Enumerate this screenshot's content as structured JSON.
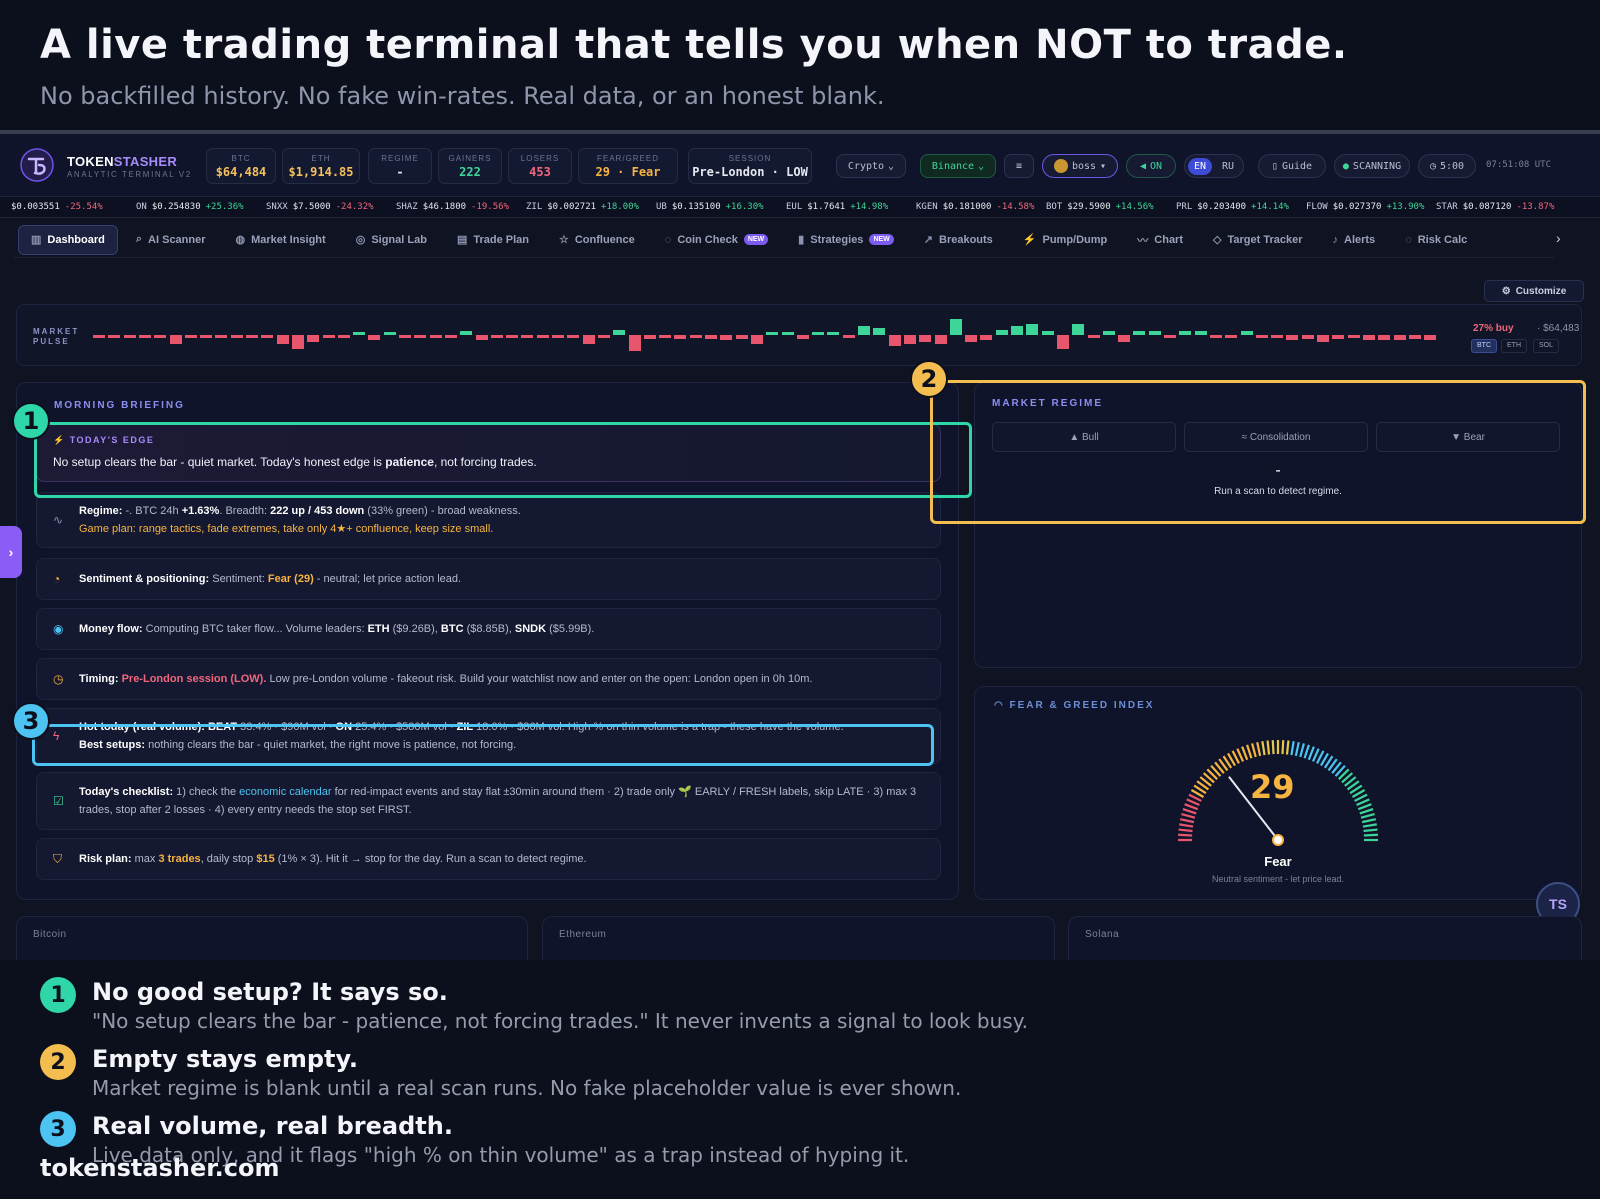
{
  "hero": {
    "title": "A live trading terminal that tells you when NOT to trade.",
    "subtitle": "No backfilled history. No fake win-rates. Real data, or an honest blank."
  },
  "app": {
    "brand_a": "TOKEN",
    "brand_b": "STASHER",
    "brand_sub": "ANALYTIC TERMINAL V2",
    "stats": [
      {
        "label": "BTC",
        "value": "$64,484",
        "color": "#f6c05a"
      },
      {
        "label": "ETH",
        "value": "$1,914.85",
        "color": "#f6c05a"
      },
      {
        "label": "REGIME",
        "value": "-",
        "color": "#e6e8f0"
      },
      {
        "label": "GAINERS",
        "value": "222",
        "color": "#3ed598"
      },
      {
        "label": "LOSERS",
        "value": "453",
        "color": "#f0677c"
      },
      {
        "label": "FEAR/GREED",
        "value": "29 · Fear",
        "color": "#f6b441"
      },
      {
        "label": "SESSION",
        "value": "Pre-London · LOW",
        "color": "#e6e8f0"
      }
    ],
    "controls": {
      "market": "Crypto",
      "exchange": "Binance",
      "user": "boss",
      "sound": "ON",
      "lang_en": "EN",
      "lang_ru": "RU",
      "guide": "Guide",
      "scanning": "SCANNING",
      "timer": "5:00",
      "clock": "07:51:08 UTC"
    },
    "ticker": [
      {
        "sym": "",
        "price": "$0.003551",
        "chg": "-25.54%"
      },
      {
        "sym": "ON",
        "price": "$0.254830",
        "chg": "+25.36%"
      },
      {
        "sym": "SNXX",
        "price": "$7.5000",
        "chg": "-24.32%"
      },
      {
        "sym": "SHAZ",
        "price": "$46.1800",
        "chg": "-19.56%"
      },
      {
        "sym": "ZIL",
        "price": "$0.002721",
        "chg": "+18.00%"
      },
      {
        "sym": "UB",
        "price": "$0.135100",
        "chg": "+16.30%"
      },
      {
        "sym": "EUL",
        "price": "$1.7641",
        "chg": "+14.98%"
      },
      {
        "sym": "KGEN",
        "price": "$0.181000",
        "chg": "-14.58%"
      },
      {
        "sym": "BOT",
        "price": "$29.5900",
        "chg": "+14.56%"
      },
      {
        "sym": "PRL",
        "price": "$0.203400",
        "chg": "+14.14%"
      },
      {
        "sym": "FLOW",
        "price": "$0.027370",
        "chg": "+13.90%"
      },
      {
        "sym": "STAR",
        "price": "$0.087120",
        "chg": "-13.87%"
      }
    ],
    "tabs": [
      {
        "label": "Dashboard",
        "icon": "▥",
        "active": true,
        "badge": ""
      },
      {
        "label": "AI Scanner",
        "icon": "⌕",
        "badge": ""
      },
      {
        "label": "Market Insight",
        "icon": "◍",
        "badge": ""
      },
      {
        "label": "Signal Lab",
        "icon": "◎",
        "badge": ""
      },
      {
        "label": "Trade Plan",
        "icon": "▤",
        "badge": ""
      },
      {
        "label": "Confluence",
        "icon": "☆",
        "badge": ""
      },
      {
        "label": "Coin Check",
        "icon": "◌",
        "badge": "NEW"
      },
      {
        "label": "Strategies",
        "icon": "▮",
        "badge": "NEW"
      },
      {
        "label": "Breakouts",
        "icon": "↗",
        "badge": ""
      },
      {
        "label": "Pump/Dump",
        "icon": "⚡",
        "badge": ""
      },
      {
        "label": "Chart",
        "icon": "〰",
        "badge": ""
      },
      {
        "label": "Target Tracker",
        "icon": "◇",
        "badge": ""
      },
      {
        "label": "Alerts",
        "icon": "♪",
        "badge": ""
      },
      {
        "label": "Risk Calc",
        "icon": "◌",
        "badge": ""
      }
    ],
    "customize": "Customize",
    "pulse": {
      "label_1": "MARKET",
      "label_2": "PULSE",
      "buy": "27% buy",
      "price": "· $64,483",
      "coins": [
        "BTC",
        "ETH",
        "SOL"
      ],
      "bars": [
        -0.1,
        -0.1,
        -0.1,
        -0.1,
        -0.1,
        -0.5,
        -0.1,
        -0.1,
        -0.1,
        -0.1,
        -0.1,
        -0.1,
        -0.5,
        -0.8,
        -0.4,
        -0.1,
        -0.1,
        0.15,
        -0.3,
        0.1,
        -0.1,
        -0.1,
        -0.1,
        -0.1,
        0.2,
        -0.3,
        -0.1,
        -0.1,
        -0.1,
        -0.1,
        -0.1,
        -0.1,
        -0.5,
        -0.1,
        0.3,
        -0.9,
        -0.2,
        -0.1,
        -0.2,
        -0.1,
        -0.2,
        -0.3,
        -0.2,
        -0.5,
        0.15,
        0.1,
        -0.2,
        0.1,
        0.15,
        -0.1,
        0.5,
        0.4,
        -0.6,
        -0.5,
        -0.4,
        -0.5,
        0.9,
        -0.4,
        -0.3,
        0.3,
        0.5,
        0.6,
        0.2,
        -0.8,
        0.6,
        -0.1,
        0.2,
        -0.4,
        0.25,
        0.2,
        -0.1,
        0.2,
        0.25,
        -0.1,
        -0.1,
        0.2,
        -0.1,
        -0.1,
        -0.3,
        -0.2,
        -0.4,
        -0.2,
        -0.1,
        -0.3,
        -0.3,
        -0.3,
        -0.2,
        -0.3
      ]
    },
    "briefing": {
      "title": "MORNING BRIEFING",
      "edge_label": "TODAY'S EDGE",
      "edge_a": "No setup clears the bar - quiet market. Today's honest edge is ",
      "edge_b": "patience",
      "edge_c": ", not forcing trades.",
      "regime_html_1": "Regime:",
      "regime_t1": " -. BTC 24h ",
      "regime_b1": "+1.63%",
      "regime_t2": ". Breadth: ",
      "regime_b2": "222 up / 453 down",
      "regime_t3": " (33% green) - broad weakness.",
      "regime_plan": "Game plan: range tactics, fade extremes, take only 4★+ confluence, keep size small.",
      "sent_b": "Sentiment & positioning:",
      "sent_t1": " Sentiment: ",
      "sent_o": "Fear (29)",
      "sent_t2": " - neutral; let price action lead.",
      "money_b": "Money flow:",
      "money_t1": " Computing BTC taker flow... Volume leaders: ",
      "money_e": "ETH",
      "money_t2": " ($9.26B), ",
      "money_btc": "BTC",
      "money_t3": " ($8.85B), ",
      "money_s": "SNDK",
      "money_t4": " ($5.99B).",
      "timing_b": "Timing:",
      "timing_r": " Pre-London session (LOW).",
      "timing_t": " Low pre-London volume - fakeout risk. Build your watchlist now and enter on the open: London open in 0h 10m.",
      "hot_b": "Hot today (real volume): BEAT",
      "hot_t1": " 33.4% · $90M vol · ",
      "hot_on": "ON",
      "hot_t2": " 25.4% · $580M vol · ",
      "hot_zil": "ZIL",
      "hot_t3": " 18.0% · $86M vol. High % on thin volume is a trap - these have the volume.",
      "hot_best": "Best setups:",
      "hot_t4": " nothing clears the bar - quiet market, the right move is patience, not forcing.",
      "check_b": "Today's checklist:",
      "check_t1": " 1) check the ",
      "check_link": "economic calendar",
      "check_t2": " for red-impact events and stay flat ±30min around them · 2) trade only 🌱 EARLY / FRESH labels, skip LATE · 3) max 3 trades, stop after 2 losses · 4) every entry needs the stop set FIRST.",
      "risk_b": "Risk plan:",
      "risk_t1": " max ",
      "risk_o1": "3 trades",
      "risk_t2": ", daily stop ",
      "risk_o2": "$15",
      "risk_t3": " (1% × 3). Hit it → stop for the day. Run a scan to detect regime."
    },
    "regime": {
      "title": "MARKET REGIME",
      "bull": "▲ Bull",
      "cons": "≈ Consolidation",
      "bear": "▼ Bear",
      "value": "-",
      "hint": "Run a scan to detect regime."
    },
    "fear": {
      "title": "FEAR & GREED INDEX",
      "value": "29",
      "label": "Fear",
      "hint": "Neutral sentiment - let price lead."
    },
    "coins_row": [
      "Bitcoin",
      "Ethereum",
      "Solana"
    ]
  },
  "callouts": [
    {
      "num": "1",
      "title": "No good setup? It says so.",
      "desc": "\"No setup clears the bar - patience, not forcing trades.\" It never invents a signal to look busy.",
      "color": "#2fd6a8"
    },
    {
      "num": "2",
      "title": "Empty stays empty.",
      "desc": "Market regime is blank until a real scan runs. No fake placeholder value is ever shown.",
      "color": "#f4bd4f"
    },
    {
      "num": "3",
      "title": "Real volume, real breadth.",
      "desc": "Live data only, and it flags \"high % on thin volume\" as a trap instead of hyping it.",
      "color": "#4cc3f0"
    }
  ],
  "site": "tokenstasher.com"
}
